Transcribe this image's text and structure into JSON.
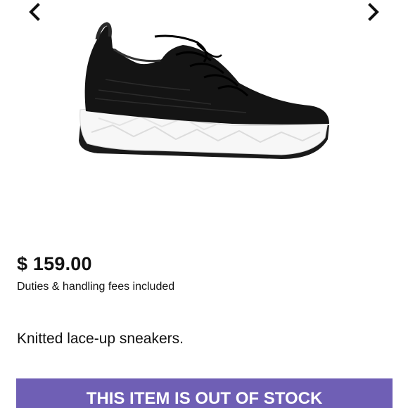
{
  "gallery": {
    "prev_icon": "chevron-left-icon",
    "next_icon": "chevron-right-icon",
    "image_subject": "black knitted lace-up sneaker with white sole"
  },
  "product": {
    "price": "$ 159.00",
    "duties_note": "Duties & handling fees included",
    "description": "Knitted lace-up sneakers."
  },
  "stock_button": {
    "label": "THIS ITEM IS OUT OF STOCK",
    "color": "#6f5fb5"
  }
}
